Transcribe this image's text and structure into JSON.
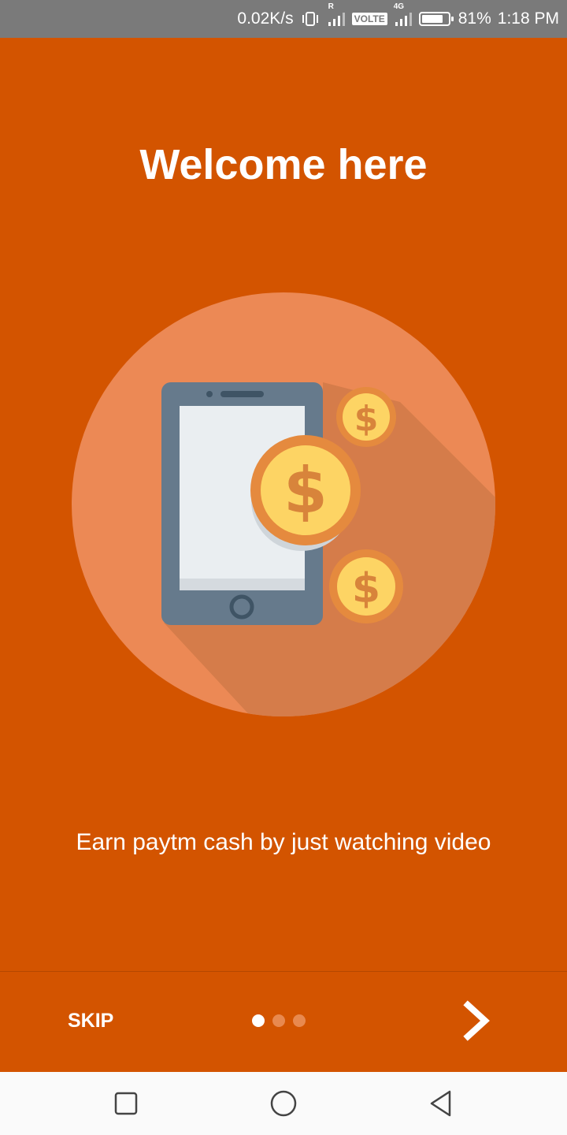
{
  "status_bar": {
    "network_speed": "0.02K/s",
    "roaming_label": "R",
    "volte_label": "VOLTE",
    "network_type": "4G",
    "battery_percent": "81%",
    "battery_level": 0.81,
    "time": "1:18 PM"
  },
  "onboarding": {
    "title": "Welcome here",
    "description": "Earn paytm cash by just watching video",
    "illustration": "phone-with-coins",
    "page_indicator": {
      "total": 3,
      "current": 1
    }
  },
  "controls": {
    "skip_label": "SKIP",
    "next_icon": "chevron-right-icon"
  },
  "navigation_bar": {
    "recent_icon": "square-icon",
    "home_icon": "circle-icon",
    "back_icon": "triangle-back-icon"
  },
  "colors": {
    "background": "#d35400",
    "circle": "#ec8955",
    "phone_body": "#667a8c",
    "screen": "#eaeef1",
    "coin": "#fdd464",
    "coin_rim": "#e58a3e"
  }
}
